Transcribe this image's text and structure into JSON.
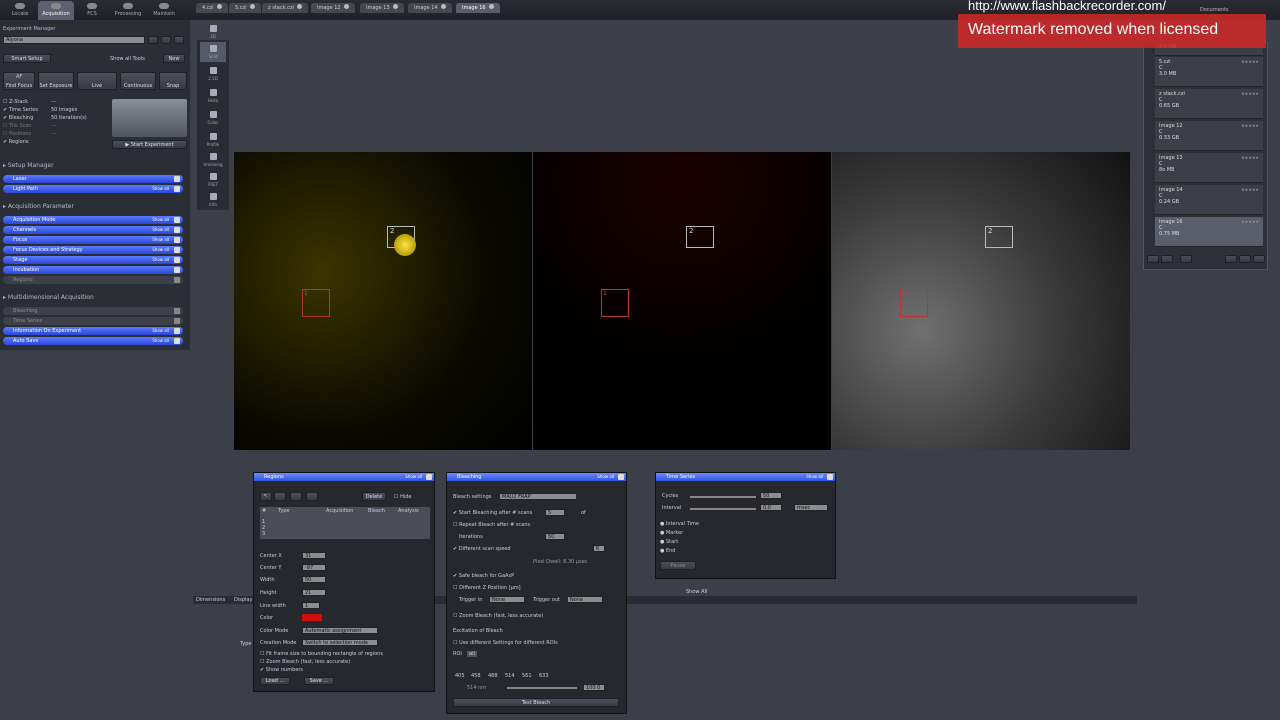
{
  "watermark": {
    "url": "http://www.flashbackrecorder.com/",
    "text": "Watermark removed when licensed"
  },
  "modules": [
    "Locate",
    "Acquisition",
    "FCS",
    "Processing",
    "Maintain"
  ],
  "image_tabs": [
    "4.czi",
    "5.czi",
    "z stack.czi",
    "Image 12",
    "Image 13",
    "Image 14",
    "Image 16"
  ],
  "experiment": {
    "label": "Experiment Manager",
    "name": "Alyona",
    "smart_setup": "Smart Setup",
    "show_all_tools": "Show all Tools",
    "new": "New"
  },
  "actions": [
    "Find Focus",
    "Set Exposure",
    "Live",
    "Continuous",
    "Snap"
  ],
  "action_short": [
    "AF",
    "",
    "",
    "",
    ""
  ],
  "options": [
    {
      "label": "Z-Stack",
      "value": "---",
      "checked": false
    },
    {
      "label": "Time Series",
      "value": "50 Images",
      "checked": true
    },
    {
      "label": "Bleaching",
      "value": "50 Iteration(s)",
      "checked": true
    },
    {
      "label": "Tile Scan",
      "value": "---",
      "checked": false,
      "dim": true
    },
    {
      "label": "Positions",
      "value": "---",
      "checked": false,
      "dim": true
    },
    {
      "label": "Regions",
      "value": "",
      "checked": true
    }
  ],
  "start_experiment": "Start Experiment",
  "setup_manager": {
    "title": "Setup Manager",
    "items": [
      {
        "label": "Laser",
        "showall": ""
      },
      {
        "label": "Light Path",
        "showall": "Show all"
      }
    ]
  },
  "acq_param": {
    "title": "Acquisition Parameter",
    "items": [
      {
        "label": "Acquisition Mode",
        "showall": "Show all"
      },
      {
        "label": "Channels",
        "showall": "Show all"
      },
      {
        "label": "Focus",
        "showall": "Show all"
      },
      {
        "label": "Focus Devices and Strategy",
        "showall": "Show all"
      },
      {
        "label": "Stage",
        "showall": "Show all"
      },
      {
        "label": "Incubation",
        "showall": ""
      }
    ],
    "regions": "Regions"
  },
  "multidim": {
    "title": "Multidimensional Acquisition",
    "bleaching": "Bleaching",
    "time_series": "Time Series",
    "info": "Information On Experiment",
    "info_showall": "Show all",
    "autosave": "Auto Save",
    "autosave_showall": "Show all"
  },
  "view_tools": [
    "2D",
    "Split",
    "2.5D",
    "Histo",
    "Coloc",
    "Profile",
    "Unmixing",
    "FRET",
    "Info"
  ],
  "rois": {
    "r1": "1",
    "r2": "2"
  },
  "regions_panel": {
    "title": "Regions",
    "showall": "Show all",
    "delete": "Delete",
    "hide": "Hide",
    "cols": [
      "#",
      "Type",
      "Acquisition",
      "Bleach",
      "Analysis"
    ],
    "rows": [
      "1",
      "2",
      "3"
    ],
    "center_x_label": "Center X",
    "center_x": "31",
    "center_y_label": "Center Y",
    "center_y": "-97",
    "width_label": "Width",
    "width": "50",
    "height_label": "Height",
    "height": "21",
    "line_width_label": "Line width",
    "line_width": "1",
    "color_label": "Color",
    "color_mode_label": "Color Mode",
    "color_mode": "Automatic assignment",
    "creation_mode_label": "Creation Mode",
    "creation_mode": "Switch to selection mode",
    "fit": "Fit frame size to bounding rectangle of regions",
    "zoom": "Zoom Bleach (fast, less accurate)",
    "shownum": "Show numbers",
    "load": "Load ...",
    "save": "Save ..."
  },
  "bleach_panel": {
    "title": "Bleaching",
    "showall": "Show all",
    "settings_label": "Bleach settings",
    "settings": "MAU2 FRAP",
    "start_after": "Start Bleaching after # scans",
    "start_val": "5",
    "of": "of",
    "repeat": "Repeat Bleach after # scans",
    "iterations_label": "Iterations",
    "iterations": "50",
    "diff_speed": "Different scan speed",
    "speed": "6",
    "pixel_dwell": "Pixel Dwell: 6.30 µsec",
    "safe": "Safe bleach for GaAsP",
    "diff_z": "Different Z Position [µm]",
    "trigger_in_label": "Trigger in",
    "trigger_in": "None",
    "trigger_out_label": "Trigger out",
    "trigger_out": "None",
    "zoom_bleach": "Zoom Bleach (fast, less accurate)",
    "excitation": "Excitation of Bleach",
    "use_diff": "Use different Settings for different ROIs",
    "roi": "ROI",
    "all": "all",
    "lines": [
      "405",
      "458",
      "488",
      "514",
      "561",
      "633"
    ],
    "nm": "514 nm",
    "power": "100.0",
    "test": "Test Bleach"
  },
  "time_panel": {
    "title": "Time Series",
    "showall": "Show all",
    "cycles_label": "Cycles",
    "cycles": "50",
    "interval_label": "Interval",
    "interval": "0.0",
    "unit": "msec",
    "opts": [
      "Interval Time",
      "Marker",
      "Start",
      "End"
    ],
    "pause": "Pause"
  },
  "bottom": {
    "dimensions": "Dimensions",
    "display": "Display",
    "type": "Type",
    "showall": "Show All"
  },
  "documents": {
    "header": "Documents",
    "entries": [
      {
        "name": "",
        "size": "3.0 MB"
      },
      {
        "name": "5.czi",
        "size": "3.0 MB"
      },
      {
        "name": "z stack.czi",
        "size": "0.65 GB"
      },
      {
        "name": "Image 12",
        "size": "0.33 GB"
      },
      {
        "name": "Image 13",
        "size": "8o MB"
      },
      {
        "name": "Image 14",
        "size": "0.24 GB"
      },
      {
        "name": "Image 16",
        "size": "0.75 MB"
      }
    ]
  }
}
